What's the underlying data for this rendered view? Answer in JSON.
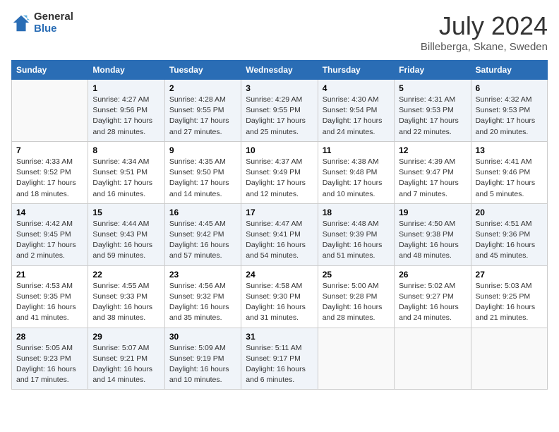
{
  "header": {
    "logo_general": "General",
    "logo_blue": "Blue",
    "month_year": "July 2024",
    "location": "Billeberga, Skane, Sweden"
  },
  "days_of_week": [
    "Sunday",
    "Monday",
    "Tuesday",
    "Wednesday",
    "Thursday",
    "Friday",
    "Saturday"
  ],
  "weeks": [
    [
      {
        "num": "",
        "sunrise": "",
        "sunset": "",
        "daylight": ""
      },
      {
        "num": "1",
        "sunrise": "Sunrise: 4:27 AM",
        "sunset": "Sunset: 9:56 PM",
        "daylight": "Daylight: 17 hours and 28 minutes."
      },
      {
        "num": "2",
        "sunrise": "Sunrise: 4:28 AM",
        "sunset": "Sunset: 9:55 PM",
        "daylight": "Daylight: 17 hours and 27 minutes."
      },
      {
        "num": "3",
        "sunrise": "Sunrise: 4:29 AM",
        "sunset": "Sunset: 9:55 PM",
        "daylight": "Daylight: 17 hours and 25 minutes."
      },
      {
        "num": "4",
        "sunrise": "Sunrise: 4:30 AM",
        "sunset": "Sunset: 9:54 PM",
        "daylight": "Daylight: 17 hours and 24 minutes."
      },
      {
        "num": "5",
        "sunrise": "Sunrise: 4:31 AM",
        "sunset": "Sunset: 9:53 PM",
        "daylight": "Daylight: 17 hours and 22 minutes."
      },
      {
        "num": "6",
        "sunrise": "Sunrise: 4:32 AM",
        "sunset": "Sunset: 9:53 PM",
        "daylight": "Daylight: 17 hours and 20 minutes."
      }
    ],
    [
      {
        "num": "7",
        "sunrise": "Sunrise: 4:33 AM",
        "sunset": "Sunset: 9:52 PM",
        "daylight": "Daylight: 17 hours and 18 minutes."
      },
      {
        "num": "8",
        "sunrise": "Sunrise: 4:34 AM",
        "sunset": "Sunset: 9:51 PM",
        "daylight": "Daylight: 17 hours and 16 minutes."
      },
      {
        "num": "9",
        "sunrise": "Sunrise: 4:35 AM",
        "sunset": "Sunset: 9:50 PM",
        "daylight": "Daylight: 17 hours and 14 minutes."
      },
      {
        "num": "10",
        "sunrise": "Sunrise: 4:37 AM",
        "sunset": "Sunset: 9:49 PM",
        "daylight": "Daylight: 17 hours and 12 minutes."
      },
      {
        "num": "11",
        "sunrise": "Sunrise: 4:38 AM",
        "sunset": "Sunset: 9:48 PM",
        "daylight": "Daylight: 17 hours and 10 minutes."
      },
      {
        "num": "12",
        "sunrise": "Sunrise: 4:39 AM",
        "sunset": "Sunset: 9:47 PM",
        "daylight": "Daylight: 17 hours and 7 minutes."
      },
      {
        "num": "13",
        "sunrise": "Sunrise: 4:41 AM",
        "sunset": "Sunset: 9:46 PM",
        "daylight": "Daylight: 17 hours and 5 minutes."
      }
    ],
    [
      {
        "num": "14",
        "sunrise": "Sunrise: 4:42 AM",
        "sunset": "Sunset: 9:45 PM",
        "daylight": "Daylight: 17 hours and 2 minutes."
      },
      {
        "num": "15",
        "sunrise": "Sunrise: 4:44 AM",
        "sunset": "Sunset: 9:43 PM",
        "daylight": "Daylight: 16 hours and 59 minutes."
      },
      {
        "num": "16",
        "sunrise": "Sunrise: 4:45 AM",
        "sunset": "Sunset: 9:42 PM",
        "daylight": "Daylight: 16 hours and 57 minutes."
      },
      {
        "num": "17",
        "sunrise": "Sunrise: 4:47 AM",
        "sunset": "Sunset: 9:41 PM",
        "daylight": "Daylight: 16 hours and 54 minutes."
      },
      {
        "num": "18",
        "sunrise": "Sunrise: 4:48 AM",
        "sunset": "Sunset: 9:39 PM",
        "daylight": "Daylight: 16 hours and 51 minutes."
      },
      {
        "num": "19",
        "sunrise": "Sunrise: 4:50 AM",
        "sunset": "Sunset: 9:38 PM",
        "daylight": "Daylight: 16 hours and 48 minutes."
      },
      {
        "num": "20",
        "sunrise": "Sunrise: 4:51 AM",
        "sunset": "Sunset: 9:36 PM",
        "daylight": "Daylight: 16 hours and 45 minutes."
      }
    ],
    [
      {
        "num": "21",
        "sunrise": "Sunrise: 4:53 AM",
        "sunset": "Sunset: 9:35 PM",
        "daylight": "Daylight: 16 hours and 41 minutes."
      },
      {
        "num": "22",
        "sunrise": "Sunrise: 4:55 AM",
        "sunset": "Sunset: 9:33 PM",
        "daylight": "Daylight: 16 hours and 38 minutes."
      },
      {
        "num": "23",
        "sunrise": "Sunrise: 4:56 AM",
        "sunset": "Sunset: 9:32 PM",
        "daylight": "Daylight: 16 hours and 35 minutes."
      },
      {
        "num": "24",
        "sunrise": "Sunrise: 4:58 AM",
        "sunset": "Sunset: 9:30 PM",
        "daylight": "Daylight: 16 hours and 31 minutes."
      },
      {
        "num": "25",
        "sunrise": "Sunrise: 5:00 AM",
        "sunset": "Sunset: 9:28 PM",
        "daylight": "Daylight: 16 hours and 28 minutes."
      },
      {
        "num": "26",
        "sunrise": "Sunrise: 5:02 AM",
        "sunset": "Sunset: 9:27 PM",
        "daylight": "Daylight: 16 hours and 24 minutes."
      },
      {
        "num": "27",
        "sunrise": "Sunrise: 5:03 AM",
        "sunset": "Sunset: 9:25 PM",
        "daylight": "Daylight: 16 hours and 21 minutes."
      }
    ],
    [
      {
        "num": "28",
        "sunrise": "Sunrise: 5:05 AM",
        "sunset": "Sunset: 9:23 PM",
        "daylight": "Daylight: 16 hours and 17 minutes."
      },
      {
        "num": "29",
        "sunrise": "Sunrise: 5:07 AM",
        "sunset": "Sunset: 9:21 PM",
        "daylight": "Daylight: 16 hours and 14 minutes."
      },
      {
        "num": "30",
        "sunrise": "Sunrise: 5:09 AM",
        "sunset": "Sunset: 9:19 PM",
        "daylight": "Daylight: 16 hours and 10 minutes."
      },
      {
        "num": "31",
        "sunrise": "Sunrise: 5:11 AM",
        "sunset": "Sunset: 9:17 PM",
        "daylight": "Daylight: 16 hours and 6 minutes."
      },
      {
        "num": "",
        "sunrise": "",
        "sunset": "",
        "daylight": ""
      },
      {
        "num": "",
        "sunrise": "",
        "sunset": "",
        "daylight": ""
      },
      {
        "num": "",
        "sunrise": "",
        "sunset": "",
        "daylight": ""
      }
    ]
  ]
}
